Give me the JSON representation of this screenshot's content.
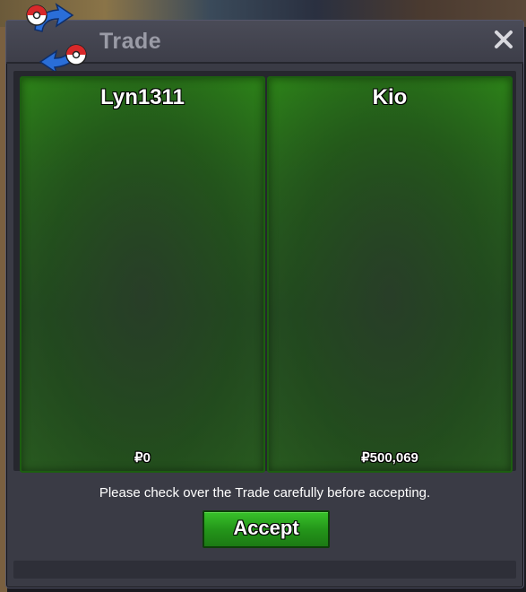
{
  "window": {
    "title": "Trade"
  },
  "trade": {
    "left": {
      "player_name": "Lyn1311",
      "money": "₽0"
    },
    "right": {
      "player_name": "Kio",
      "money": "₽500,069"
    }
  },
  "notice": "Please check over the Trade carefully before accepting.",
  "accept_label": "Accept",
  "icons": {
    "logo": "trade-exchange-icon",
    "close": "close-icon"
  },
  "colors": {
    "panel_green": "#2a6a1e",
    "button_green": "#24961a",
    "window_bg": "#3a3b45"
  }
}
